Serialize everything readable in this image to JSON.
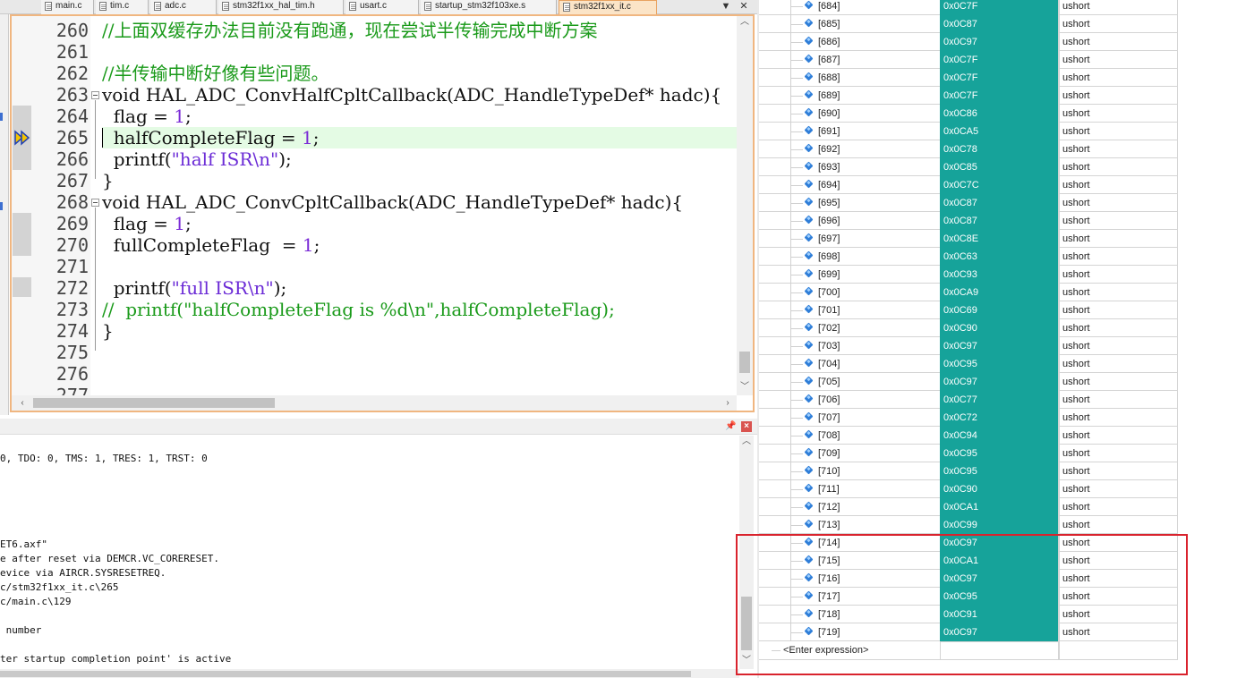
{
  "tabs": [
    {
      "label": "main.c"
    },
    {
      "label": "tim.c"
    },
    {
      "label": "adc.c"
    },
    {
      "label": "stm32f1xx_hal_tim.h"
    },
    {
      "label": "usart.c"
    },
    {
      "label": "startup_stm32f103xe.s"
    },
    {
      "label": "stm32f1xx_it.c"
    }
  ],
  "tab_controls": {
    "dropdown": "▼",
    "close": "✕"
  },
  "editor": {
    "lines": [
      {
        "num": "260",
        "segs": [
          {
            "t": "//上面双缓存办法目前没有跑通，现在尝试半传输完成中断方案",
            "c": "cmt"
          }
        ]
      },
      {
        "num": "261",
        "segs": []
      },
      {
        "num": "262",
        "segs": [
          {
            "t": "//半传输中断好像有些问题。",
            "c": "cmt"
          }
        ]
      },
      {
        "num": "263",
        "segs": [
          {
            "t": "void",
            "c": "kw"
          },
          {
            "t": " HAL_ADC_ConvHalfCpltCallback(ADC_HandleTypeDef* hadc){",
            "c": ""
          }
        ]
      },
      {
        "num": "264",
        "segs": [
          {
            "t": "  flag = ",
            "c": ""
          },
          {
            "t": "1",
            "c": "num"
          },
          {
            "t": ";",
            "c": ""
          }
        ]
      },
      {
        "num": "265",
        "segs": [
          {
            "t": "  halfCompleteFlag = ",
            "c": ""
          },
          {
            "t": "1",
            "c": "num"
          },
          {
            "t": ";",
            "c": ""
          }
        ]
      },
      {
        "num": "266",
        "segs": [
          {
            "t": "  printf(",
            "c": ""
          },
          {
            "t": "\"half ISR\\n\"",
            "c": "str"
          },
          {
            "t": ");",
            "c": ""
          }
        ]
      },
      {
        "num": "267",
        "segs": [
          {
            "t": "}",
            "c": ""
          }
        ]
      },
      {
        "num": "268",
        "segs": [
          {
            "t": "void",
            "c": "kw"
          },
          {
            "t": " HAL_ADC_ConvCpltCallback(ADC_HandleTypeDef* hadc){",
            "c": ""
          }
        ]
      },
      {
        "num": "269",
        "segs": [
          {
            "t": "  flag = ",
            "c": ""
          },
          {
            "t": "1",
            "c": "num"
          },
          {
            "t": ";",
            "c": ""
          }
        ]
      },
      {
        "num": "270",
        "segs": [
          {
            "t": "  fullCompleteFlag  = ",
            "c": ""
          },
          {
            "t": "1",
            "c": "num"
          },
          {
            "t": ";",
            "c": ""
          }
        ]
      },
      {
        "num": "271",
        "segs": []
      },
      {
        "num": "272",
        "segs": [
          {
            "t": "  printf(",
            "c": ""
          },
          {
            "t": "\"full ISR\\n\"",
            "c": "str"
          },
          {
            "t": ");",
            "c": ""
          }
        ]
      },
      {
        "num": "273",
        "segs": [
          {
            "t": "//  printf(\"halfCompleteFlag is %d\\n\",halfCompleteFlag);",
            "c": "cmt"
          }
        ]
      },
      {
        "num": "274",
        "segs": [
          {
            "t": "}",
            "c": ""
          }
        ]
      },
      {
        "num": "275",
        "segs": []
      },
      {
        "num": "276",
        "segs": []
      },
      {
        "num": "277",
        "segs": []
      }
    ],
    "current_line": "265"
  },
  "output": {
    "lines": [
      "0, TDO: 0, TMS: 1, TRES: 1, TRST: 0",
      "",
      "",
      "",
      "",
      "",
      "ET6.axf\"",
      "e after reset via DEMCR.VC_CORERESET.",
      "evice via AIRCR.SYSRESETREQ.",
      "c/stm32f1xx_it.c\\265",
      "c/main.c\\129",
      "",
      " number",
      "",
      "ter startup completion point' is active"
    ],
    "pin_icon": "pin-icon",
    "close_icon": "close-icon"
  },
  "watch": {
    "rows": [
      {
        "name": "[684]",
        "value": "0x0C7F",
        "type": "ushort"
      },
      {
        "name": "[685]",
        "value": "0x0C87",
        "type": "ushort"
      },
      {
        "name": "[686]",
        "value": "0x0C97",
        "type": "ushort"
      },
      {
        "name": "[687]",
        "value": "0x0C7F",
        "type": "ushort"
      },
      {
        "name": "[688]",
        "value": "0x0C7F",
        "type": "ushort"
      },
      {
        "name": "[689]",
        "value": "0x0C7F",
        "type": "ushort"
      },
      {
        "name": "[690]",
        "value": "0x0C86",
        "type": "ushort"
      },
      {
        "name": "[691]",
        "value": "0x0CA5",
        "type": "ushort"
      },
      {
        "name": "[692]",
        "value": "0x0C78",
        "type": "ushort"
      },
      {
        "name": "[693]",
        "value": "0x0C85",
        "type": "ushort"
      },
      {
        "name": "[694]",
        "value": "0x0C7C",
        "type": "ushort"
      },
      {
        "name": "[695]",
        "value": "0x0C87",
        "type": "ushort"
      },
      {
        "name": "[696]",
        "value": "0x0C87",
        "type": "ushort"
      },
      {
        "name": "[697]",
        "value": "0x0C8E",
        "type": "ushort"
      },
      {
        "name": "[698]",
        "value": "0x0C63",
        "type": "ushort"
      },
      {
        "name": "[699]",
        "value": "0x0C93",
        "type": "ushort"
      },
      {
        "name": "[700]",
        "value": "0x0CA9",
        "type": "ushort"
      },
      {
        "name": "[701]",
        "value": "0x0C69",
        "type": "ushort"
      },
      {
        "name": "[702]",
        "value": "0x0C90",
        "type": "ushort"
      },
      {
        "name": "[703]",
        "value": "0x0C97",
        "type": "ushort"
      },
      {
        "name": "[704]",
        "value": "0x0C95",
        "type": "ushort"
      },
      {
        "name": "[705]",
        "value": "0x0C97",
        "type": "ushort"
      },
      {
        "name": "[706]",
        "value": "0x0C77",
        "type": "ushort"
      },
      {
        "name": "[707]",
        "value": "0x0C72",
        "type": "ushort"
      },
      {
        "name": "[708]",
        "value": "0x0C94",
        "type": "ushort"
      },
      {
        "name": "[709]",
        "value": "0x0C95",
        "type": "ushort"
      },
      {
        "name": "[710]",
        "value": "0x0C95",
        "type": "ushort"
      },
      {
        "name": "[711]",
        "value": "0x0C90",
        "type": "ushort"
      },
      {
        "name": "[712]",
        "value": "0x0CA1",
        "type": "ushort"
      },
      {
        "name": "[713]",
        "value": "0x0C99",
        "type": "ushort"
      },
      {
        "name": "[714]",
        "value": "0x0C97",
        "type": "ushort"
      },
      {
        "name": "[715]",
        "value": "0x0CA1",
        "type": "ushort"
      },
      {
        "name": "[716]",
        "value": "0x0C97",
        "type": "ushort"
      },
      {
        "name": "[717]",
        "value": "0x0C95",
        "type": "ushort"
      },
      {
        "name": "[718]",
        "value": "0x0C91",
        "type": "ushort"
      },
      {
        "name": "[719]",
        "value": "0x0C97",
        "type": "ushort"
      }
    ],
    "enter_expression": "<Enter expression>"
  },
  "colors": {
    "value_cell_bg": "#16a39a",
    "highlight_box": "#d9232d",
    "active_tab": "#fbe4c7",
    "comment": "#1a9a1a",
    "current_line_bg": "#e4fbe4"
  },
  "icons": {
    "execution_arrow": "current-execution-arrow-icon",
    "watch_item": "diamond-variable-icon"
  }
}
